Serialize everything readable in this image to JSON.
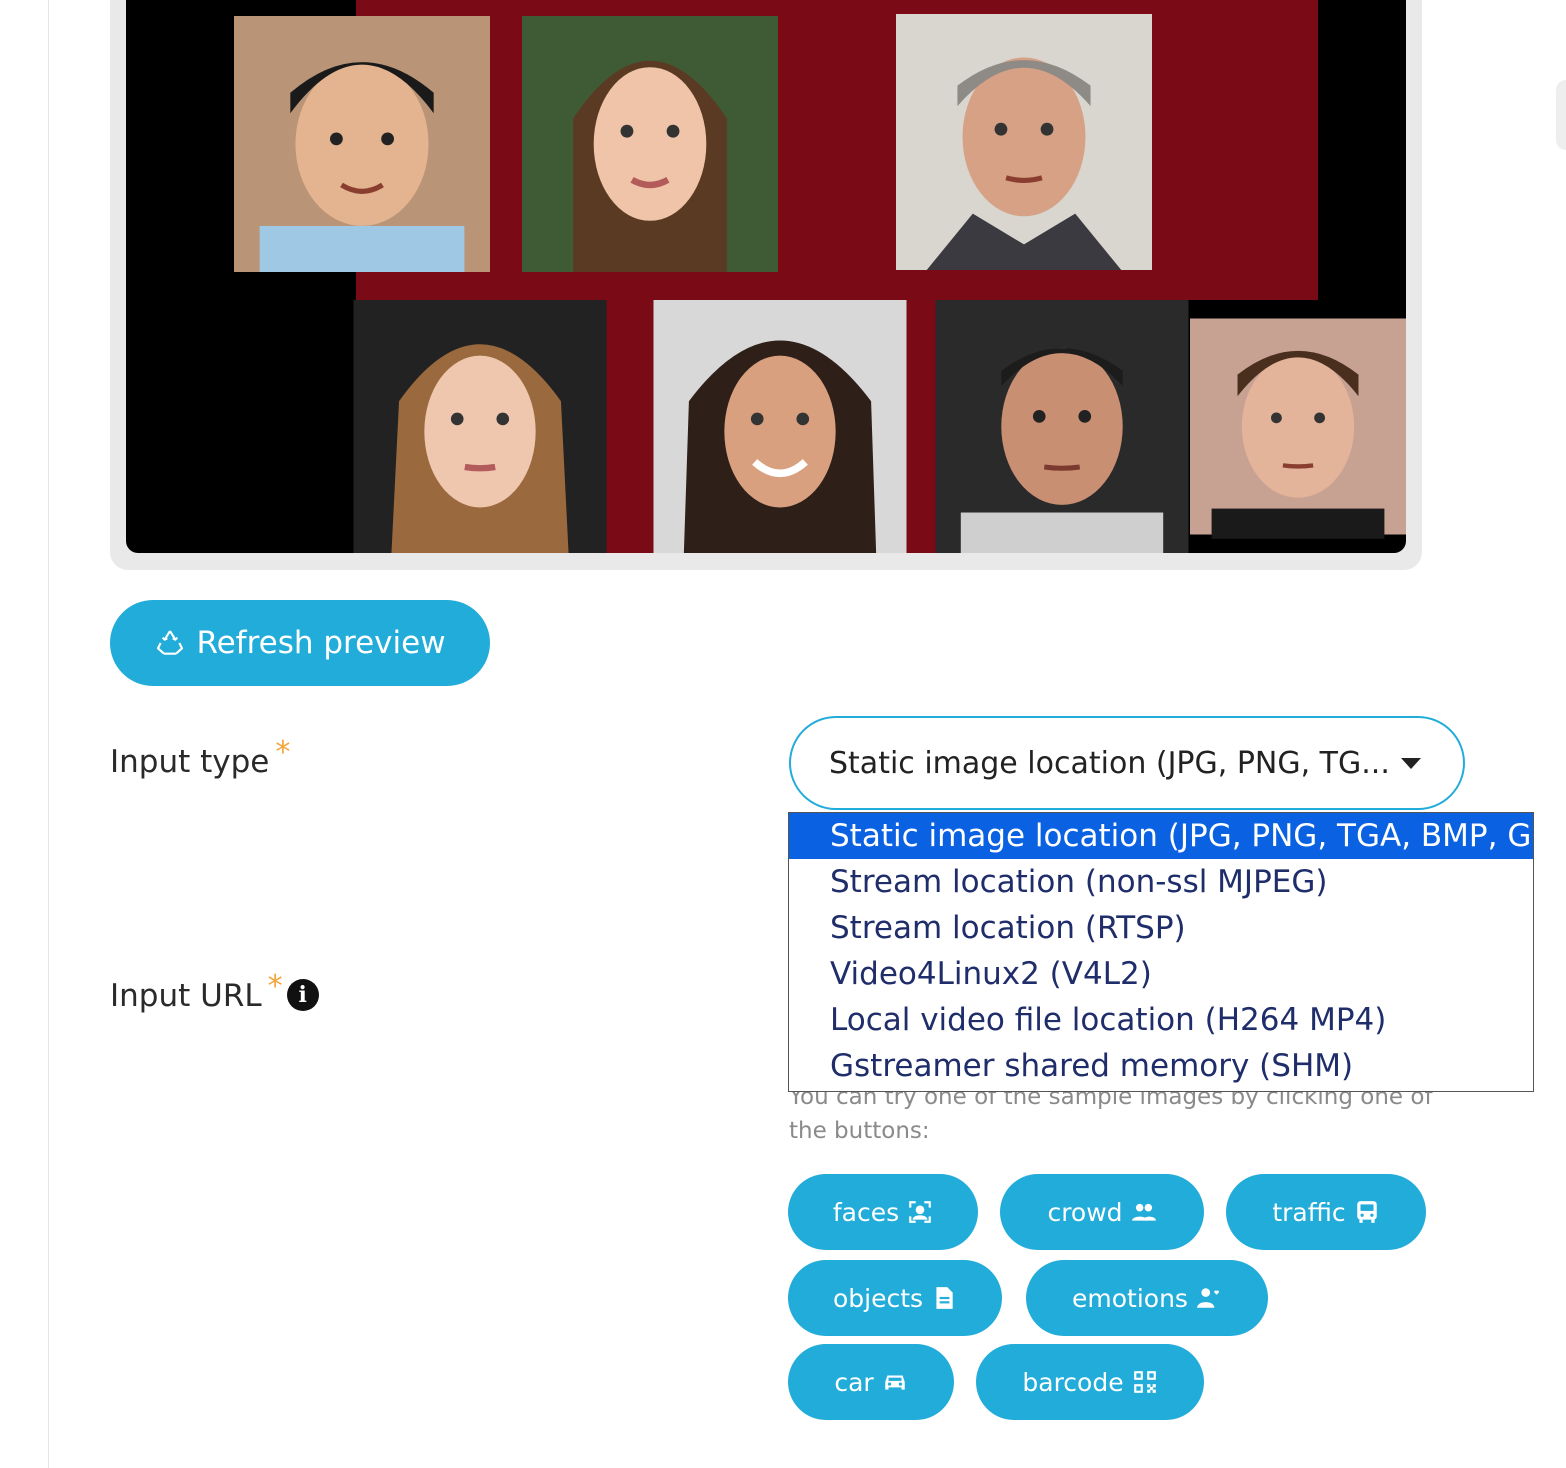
{
  "preview": {
    "faces": [
      "face-1",
      "face-2",
      "face-3",
      "face-4",
      "face-5",
      "face-6",
      "face-7"
    ]
  },
  "refresh_button": {
    "label": "Refresh preview",
    "icon": "recycle-icon"
  },
  "form": {
    "input_type": {
      "label": "Input type",
      "required_mark": "*",
      "selected_display": "Static image location (JPG, PNG, TG...",
      "options": [
        "Static image location (JPG, PNG, TGA, BMP, GIF)",
        "Stream location (non-ssl MJPEG)",
        "Stream location (RTSP)",
        "Video4Linux2 (V4L2)",
        "Local video file location (H264 MP4)",
        "Gstreamer shared memory (SHM)"
      ],
      "selected_index": 0
    },
    "input_url": {
      "label": "Input URL",
      "required_mark": "*",
      "info_symbol": "i"
    },
    "helper_text": "You can try one of the sample images by clicking one of the buttons:",
    "samples": [
      {
        "label": "faces",
        "icon": "face-scan-icon"
      },
      {
        "label": "crowd",
        "icon": "users-icon"
      },
      {
        "label": "traffic",
        "icon": "bus-icon"
      },
      {
        "label": "objects",
        "icon": "document-icon"
      },
      {
        "label": "emotions",
        "icon": "user-heart-icon"
      },
      {
        "label": "car",
        "icon": "car-icon"
      },
      {
        "label": "barcode",
        "icon": "qr-code-icon"
      }
    ]
  },
  "colors": {
    "accent": "#22acd9",
    "required": "#f4a53c",
    "dropdown_selected": "#0a62e3",
    "preview_maroon": "#7b0a17"
  }
}
